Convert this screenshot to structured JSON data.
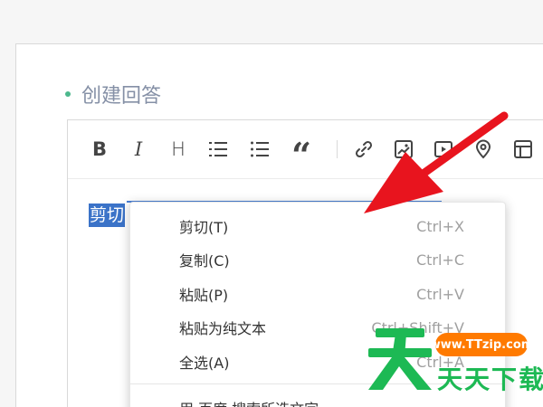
{
  "section": {
    "title": "创建回答"
  },
  "toolbar": {
    "buttons": [
      {
        "label": "B",
        "icon": "bold-icon"
      },
      {
        "label": "I",
        "icon": "italic-icon"
      },
      {
        "label": "H",
        "icon": "heading-icon"
      },
      {
        "icon": "ordered-list-icon"
      },
      {
        "icon": "unordered-list-icon"
      },
      {
        "icon": "quote-icon"
      },
      {
        "icon": "link-icon"
      },
      {
        "icon": "image-icon"
      },
      {
        "icon": "video-icon"
      },
      {
        "icon": "location-icon"
      },
      {
        "icon": "table-icon"
      }
    ],
    "quote_glyph": "“"
  },
  "editor": {
    "selected_text": "剪切"
  },
  "context_menu": {
    "items": [
      {
        "label": "剪切(T)",
        "shortcut": "Ctrl+X"
      },
      {
        "label": "复制(C)",
        "shortcut": "Ctrl+C"
      },
      {
        "label": "粘贴(P)",
        "shortcut": "Ctrl+V"
      },
      {
        "label": "粘贴为纯文本",
        "shortcut": "Ctrl+Shift+V"
      },
      {
        "label": "全选(A)",
        "shortcut": "Ctrl+A"
      }
    ],
    "partial_item": "用 百度 搜索所选文字"
  },
  "watermark": {
    "site": "www.TTzip.com",
    "brand": "天天下载"
  },
  "colors": {
    "accent_green": "#4cb88d",
    "selection_blue": "#3b73c8",
    "annotation_red": "#e8141e",
    "watermark_orange": "#ff7a00",
    "watermark_green": "#1db954"
  }
}
